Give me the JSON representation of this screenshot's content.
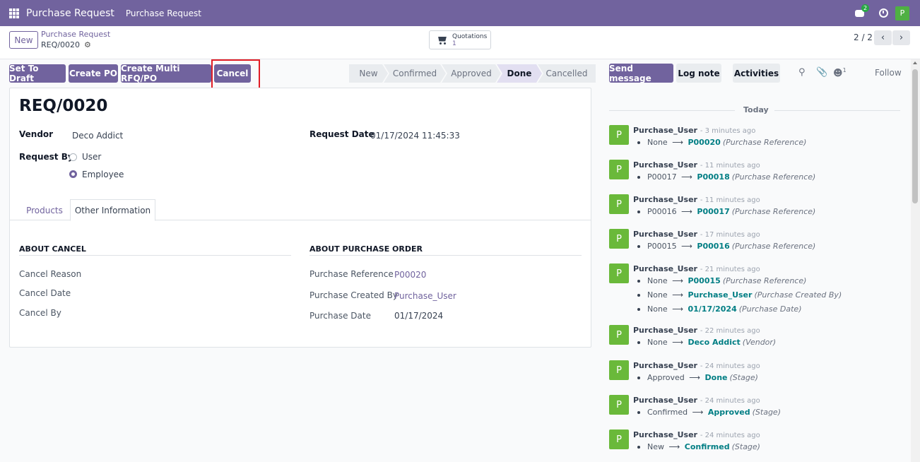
{
  "navbar": {
    "app_name": "Purchase Request",
    "menu": "Purchase Request",
    "chat_badge": "2",
    "user_initial": "P"
  },
  "control": {
    "new_label": "New",
    "breadcrumb_parent": "Purchase Request",
    "breadcrumb_current": "REQ/0020",
    "quotations_label": "Quotations",
    "quotations_count": "1",
    "pager": "2 / 2"
  },
  "actions": {
    "set_to_draft": "Set To Draft",
    "create_po": "Create PO",
    "create_multi": "Create Multi RFQ/PO",
    "cancel": "Cancel"
  },
  "statusbar": {
    "stages": [
      "New",
      "Confirmed",
      "Approved",
      "Done",
      "Cancelled"
    ],
    "active": "Done"
  },
  "form": {
    "title": "REQ/0020",
    "vendor_label": "Vendor",
    "vendor_value": "Deco Addict",
    "request_date_label": "Request Date",
    "request_date_value": "01/17/2024 11:45:33",
    "request_by_label": "Request By",
    "request_by_options": [
      "User",
      "Employee"
    ],
    "request_by_selected": "Employee",
    "tabs": [
      "Products",
      "Other Information"
    ],
    "active_tab": "Other Information",
    "about_cancel": {
      "title": "ABOUT CANCEL",
      "fields": [
        "Cancel Reason",
        "Cancel Date",
        "Cancel By"
      ]
    },
    "about_po": {
      "title": "ABOUT PURCHASE ORDER",
      "purchase_reference_label": "Purchase Reference",
      "purchase_reference_value": "P00020",
      "purchase_created_by_label": "Purchase Created By",
      "purchase_created_by_value": "Purchase_User",
      "purchase_date_label": "Purchase Date",
      "purchase_date_value": "01/17/2024"
    }
  },
  "chatter": {
    "send_message": "Send message",
    "log_note": "Log note",
    "activities": "Activities",
    "followers_count": "1",
    "follow": "Follow",
    "today": "Today",
    "messages": [
      {
        "author": "Purchase_User",
        "time": "- 3 minutes ago",
        "changes": [
          {
            "old": "None",
            "new": "P00020",
            "field": "(Purchase Reference)"
          }
        ]
      },
      {
        "author": "Purchase_User",
        "time": "- 11 minutes ago",
        "changes": [
          {
            "old": "P00017",
            "new": "P00018",
            "field": "(Purchase Reference)"
          }
        ]
      },
      {
        "author": "Purchase_User",
        "time": "- 11 minutes ago",
        "changes": [
          {
            "old": "P00016",
            "new": "P00017",
            "field": "(Purchase Reference)"
          }
        ]
      },
      {
        "author": "Purchase_User",
        "time": "- 17 minutes ago",
        "changes": [
          {
            "old": "P00015",
            "new": "P00016",
            "field": "(Purchase Reference)"
          }
        ]
      },
      {
        "author": "Purchase_User",
        "time": "- 21 minutes ago",
        "changes": [
          {
            "old": "None",
            "new": "P00015",
            "field": "(Purchase Reference)"
          },
          {
            "old": "None",
            "new": "Purchase_User",
            "field": "(Purchase Created By)"
          },
          {
            "old": "None",
            "new": "01/17/2024",
            "field": "(Purchase Date)"
          }
        ]
      },
      {
        "author": "Purchase_User",
        "time": "- 22 minutes ago",
        "changes": [
          {
            "old": "None",
            "new": "Deco Addict",
            "field": "(Vendor)"
          }
        ]
      },
      {
        "author": "Purchase_User",
        "time": "- 24 minutes ago",
        "changes": [
          {
            "old": "Approved",
            "new": "Done",
            "field": "(Stage)"
          }
        ]
      },
      {
        "author": "Purchase_User",
        "time": "- 24 minutes ago",
        "changes": [
          {
            "old": "Confirmed",
            "new": "Approved",
            "field": "(Stage)"
          }
        ]
      },
      {
        "author": "Purchase_User",
        "time": "- 24 minutes ago",
        "changes": [
          {
            "old": "New",
            "new": "Confirmed",
            "field": "(Stage)"
          }
        ]
      }
    ]
  }
}
